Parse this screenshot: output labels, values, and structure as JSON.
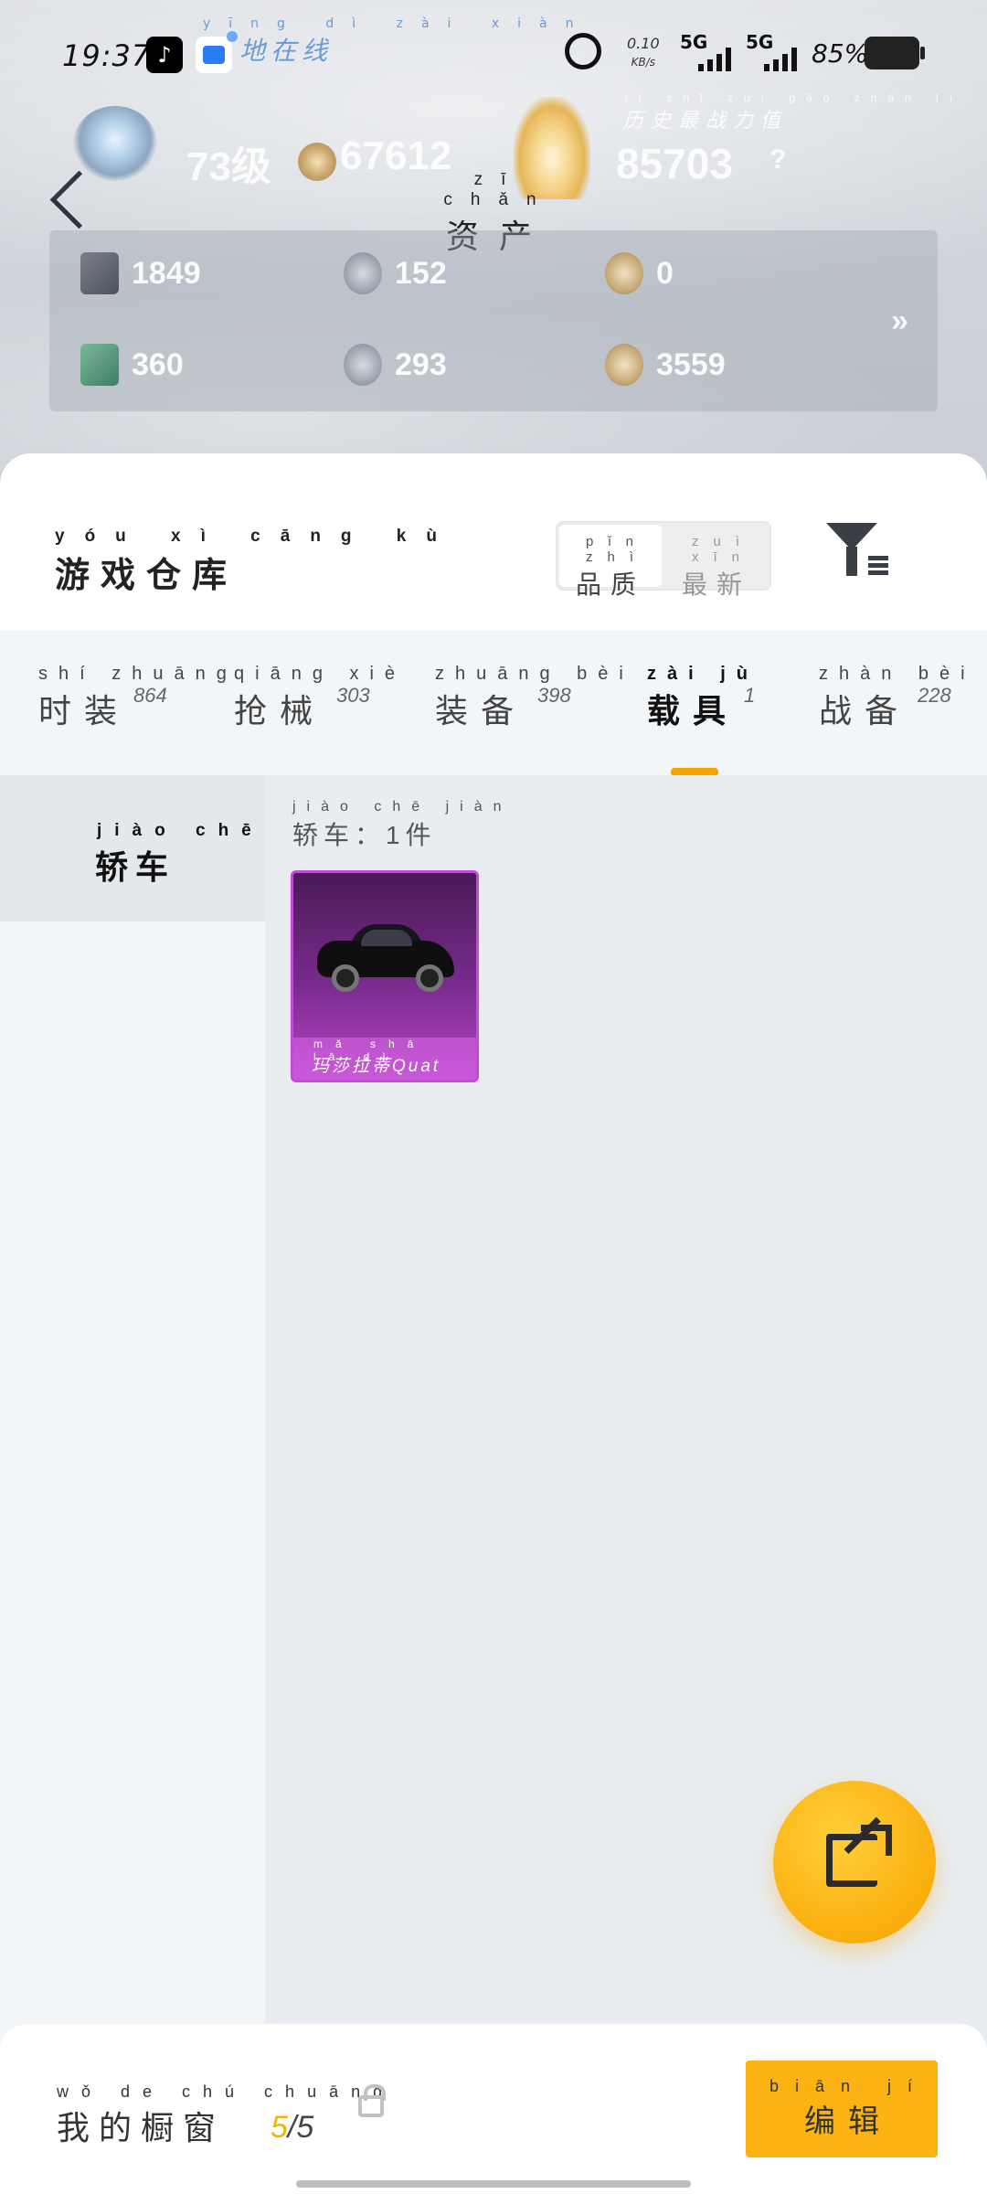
{
  "status_bar": {
    "time": "19:37",
    "tiktok_icon": "tiktok-icon",
    "location_pinyin": "yīng dì zài xiàn",
    "location_label": "地在线",
    "net_speed": "0.10",
    "net_unit": "KB/s",
    "signal1": "5G",
    "signal2": "5G",
    "battery": "85%"
  },
  "profile": {
    "level": "73级",
    "points": "67612",
    "history_pinyin": "lì shǐ zuì gāo zhàn lì",
    "history_label": "历史最战力值",
    "power": "85703",
    "help": "?"
  },
  "header": {
    "title_pinyin": "zī chǎn",
    "title": "资产"
  },
  "assets": [
    {
      "value": "1849",
      "icon": "card-icon"
    },
    {
      "value": "152",
      "icon": "silver-coin-icon"
    },
    {
      "value": "0",
      "icon": "gold-coin-icon"
    },
    {
      "value": "360",
      "icon": "green-card-icon"
    },
    {
      "value": "293",
      "icon": "token-icon"
    },
    {
      "value": "3559",
      "icon": "bronze-coin-icon"
    }
  ],
  "assets_more": "»",
  "warehouse": {
    "title_pinyin": "yóu xì cāng kù",
    "title": "游戏仓库",
    "sort_options": [
      {
        "pinyin": "pǐn zhì",
        "label": "品质",
        "active": true
      },
      {
        "pinyin": "zuì xīn",
        "label": "最新",
        "active": false
      }
    ]
  },
  "tabs": [
    {
      "pinyin": "shí zhuāng",
      "label": "时装",
      "count": "864"
    },
    {
      "pinyin": "qiāng xiè",
      "label": "抢械",
      "count": "303"
    },
    {
      "pinyin": "zhuāng bèi",
      "label": "装备",
      "count": "398"
    },
    {
      "pinyin": "zài jù",
      "label": "载具",
      "count": "1",
      "active": true
    },
    {
      "pinyin": "zhàn bèi",
      "label": "战备",
      "count": "228"
    }
  ],
  "sidebar": {
    "category_pinyin": "jiào chē",
    "category": "轿车"
  },
  "group": {
    "title_pinyin": "jiào chē jiàn",
    "title": "轿车：1件"
  },
  "items": [
    {
      "name_pinyin": "mǎ shā lā dì",
      "name": "玛莎拉蒂Quat",
      "rarity_color": "#b745c9"
    }
  ],
  "showcase": {
    "pinyin": "wǒ de chú chuāng",
    "label": "我的橱窗",
    "count_current": "5",
    "count_total": "/5"
  },
  "edit_button": {
    "pinyin": "biān jí",
    "label": "编辑"
  },
  "colors": {
    "accent": "#fbb314",
    "tab_indicator": "#f5a300",
    "epic": "#b745c9"
  }
}
